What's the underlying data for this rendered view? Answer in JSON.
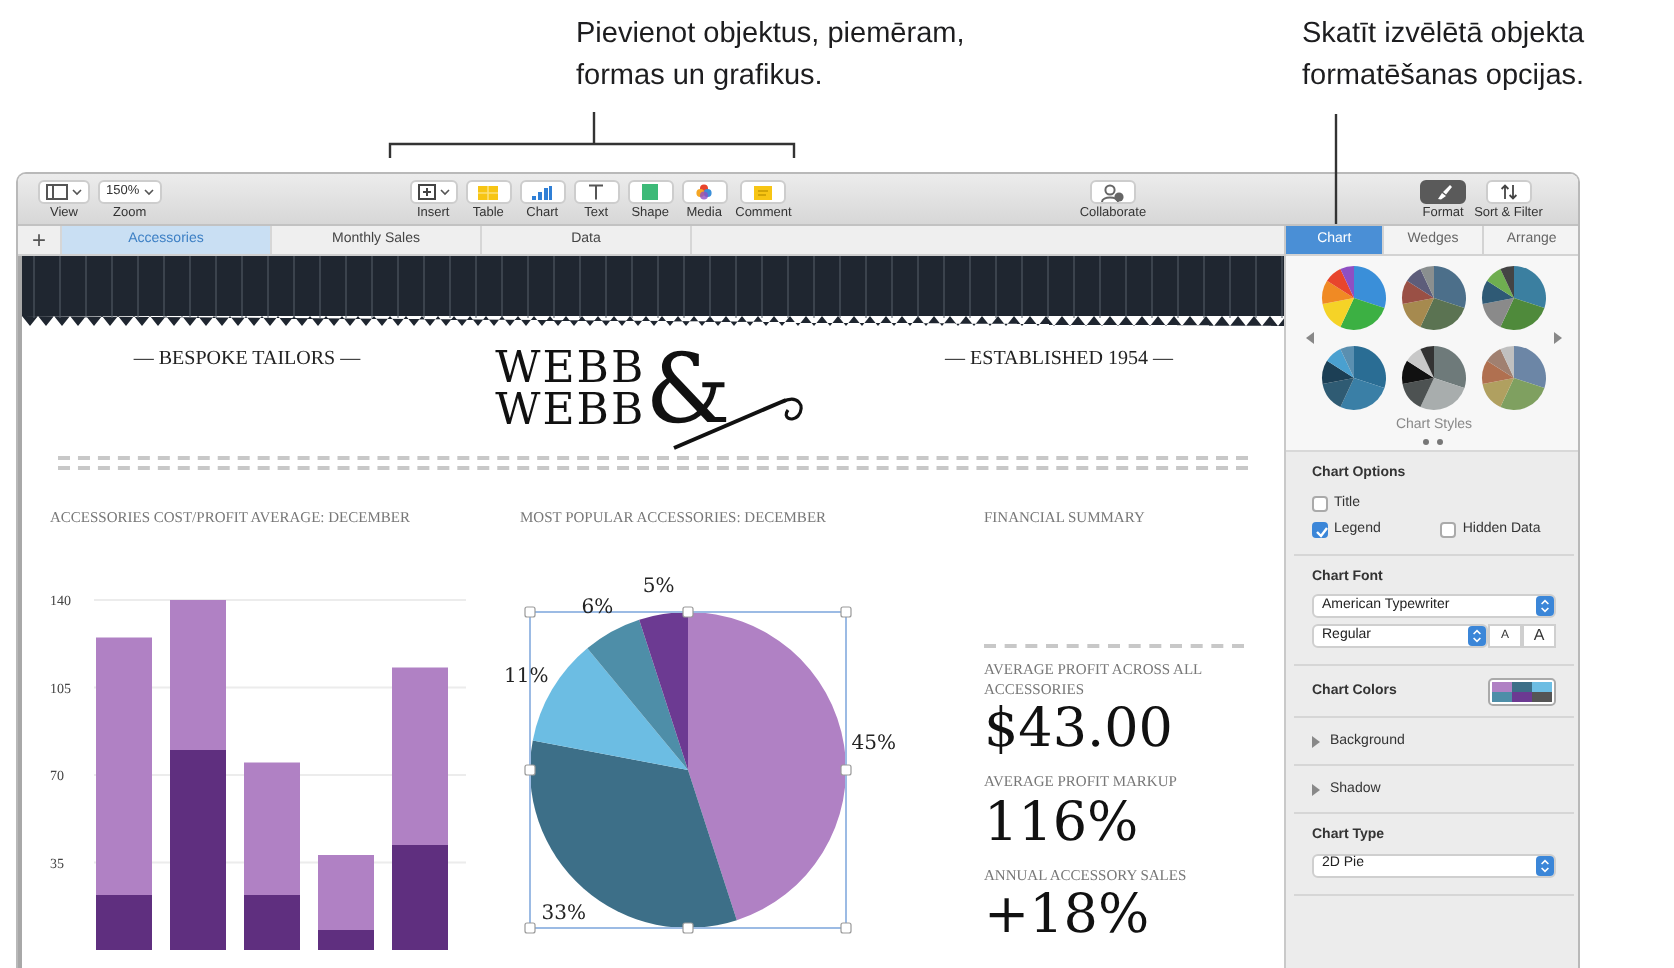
{
  "callouts": [
    {
      "text": "Pievienot objektus, piemēram, formas un grafikus."
    },
    {
      "text": "Skatīt izvēlētā objekta formatēšanas opcijas."
    }
  ],
  "toolbar": {
    "left": [
      {
        "kind": "view",
        "label": "View"
      },
      {
        "kind": "zoom",
        "label": "Zoom",
        "value": "150%"
      }
    ],
    "insert": [
      {
        "kind": "insert",
        "label": "Insert"
      },
      {
        "kind": "table",
        "label": "Table"
      },
      {
        "kind": "chart",
        "label": "Chart"
      },
      {
        "kind": "text",
        "label": "Text"
      },
      {
        "kind": "shape",
        "label": "Shape"
      },
      {
        "kind": "media",
        "label": "Media"
      },
      {
        "kind": "comment",
        "label": "Comment"
      }
    ],
    "middle": [
      {
        "kind": "collaborate",
        "label": "Collaborate"
      }
    ],
    "right": [
      {
        "kind": "format",
        "label": "Format",
        "selected": true
      },
      {
        "kind": "sort",
        "label": "Sort & Filter",
        "selected": false
      }
    ]
  },
  "sheets": {
    "add": "+",
    "tabs": [
      {
        "label": "Accessories",
        "selected": true
      },
      {
        "label": "Monthly Sales",
        "selected": false
      },
      {
        "label": "Data",
        "selected": false
      }
    ]
  },
  "document": {
    "tagline_left": "— BESPOKE TAILORS —",
    "logo": {
      "line_1": "WEBB",
      "line_2": "WEBB",
      "ampersand": "&"
    },
    "tagline_right": "— ESTABLISHED 1954 —",
    "sections": [
      {
        "kind": "bar",
        "title": "ACCESSORIES COST/PROFIT AVERAGE: DECEMBER",
        "chart_data": {
          "type": "bar",
          "stacked": true,
          "grid": true,
          "ylim": [
            0,
            140
          ],
          "yticks": [
            35,
            70,
            105,
            140
          ],
          "series": [
            {
              "color": "#5f2f7f",
              "values": [
                22,
                80,
                22,
                8,
                42
              ]
            },
            {
              "color": "#b081c4",
              "values": [
                103,
                60,
                53,
                30,
                71
              ]
            }
          ]
        }
      },
      {
        "kind": "pie",
        "title": "MOST POPULAR ACCESSORIES: DECEMBER",
        "selected": true,
        "chart_data": {
          "type": "pie",
          "values": [
            45,
            33,
            11,
            6,
            5
          ],
          "value_labels": [
            "45%",
            "33%",
            "11%",
            "6%",
            "5%"
          ]
        }
      },
      {
        "kind": "summary",
        "title": "FINANCIAL SUMMARY",
        "metrics": [
          {
            "label": "AVERAGE PROFIT ACROSS ALL ACCESSORIES",
            "value": "$43.00"
          },
          {
            "label": "AVERAGE PROFIT MARKUP",
            "value": "116%"
          },
          {
            "label": "ANNUAL ACCESSORY SALES",
            "value": "+18%"
          }
        ]
      }
    ]
  },
  "sidebar": {
    "tabs": [
      {
        "label": "Chart",
        "selected": true
      },
      {
        "label": "Wedges",
        "selected": false
      },
      {
        "label": "Arrange",
        "selected": false
      }
    ],
    "styles": {
      "caption": "Chart Styles"
    },
    "options": {
      "heading": "Chart Options",
      "checkboxes": [
        {
          "label": "Title",
          "checked": false
        },
        {
          "label": "Legend",
          "checked": true
        },
        {
          "label": "Hidden Data",
          "checked": false
        }
      ]
    },
    "font": {
      "heading": "Chart Font",
      "family": "American Typewriter",
      "style": "Regular",
      "smaller": "A",
      "larger": "A"
    },
    "colors": {
      "heading": "Chart Colors"
    },
    "disclosures": [
      {
        "label": "Background",
        "expanded": false
      },
      {
        "label": "Shadow",
        "expanded": false
      }
    ],
    "type": {
      "heading": "Chart Type",
      "value": "2D Pie"
    }
  }
}
